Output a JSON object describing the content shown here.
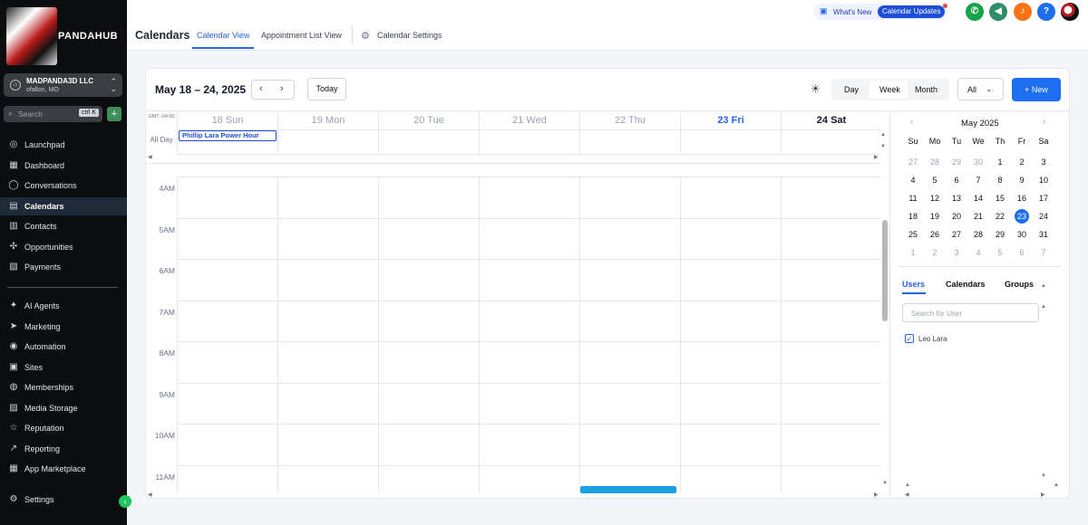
{
  "brand": {
    "name": "PANDAHUB"
  },
  "account": {
    "name": "MADPANDA3D LLC",
    "location": "ofallon, MO"
  },
  "sidebar_search": {
    "placeholder": "Search",
    "shortcut": "ctrl K"
  },
  "nav": {
    "primary": [
      {
        "label": "Launchpad",
        "icon": "rocket-icon"
      },
      {
        "label": "Dashboard",
        "icon": "grid-icon"
      },
      {
        "label": "Conversations",
        "icon": "chat-icon"
      },
      {
        "label": "Calendars",
        "icon": "calendar-icon",
        "active": true
      },
      {
        "label": "Contacts",
        "icon": "contacts-icon"
      },
      {
        "label": "Opportunities",
        "icon": "opportunities-icon"
      },
      {
        "label": "Payments",
        "icon": "payments-icon"
      }
    ],
    "secondary": [
      {
        "label": "AI Agents",
        "icon": "sparkle-icon"
      },
      {
        "label": "Marketing",
        "icon": "send-icon"
      },
      {
        "label": "Automation",
        "icon": "automation-icon"
      },
      {
        "label": "Sites",
        "icon": "sites-icon"
      },
      {
        "label": "Memberships",
        "icon": "memberships-icon"
      },
      {
        "label": "Media Storage",
        "icon": "media-icon"
      },
      {
        "label": "Reputation",
        "icon": "star-icon"
      },
      {
        "label": "Reporting",
        "icon": "chart-icon"
      },
      {
        "label": "App Marketplace",
        "icon": "apps-icon"
      }
    ],
    "settings": {
      "label": "Settings",
      "icon": "gear-icon"
    }
  },
  "header": {
    "title": "Calendars",
    "tabs": [
      "Calendar View",
      "Appointment List View",
      "Calendar Settings"
    ],
    "whats_new": "What's New",
    "updates_badge": "Calendar Updates",
    "help": "?",
    "colors": {
      "phone": "#16a34a",
      "megaphone": "#2f8f6b",
      "bell": "#f97316",
      "help": "#1d6ef0"
    }
  },
  "toolbar": {
    "date_range": "May 18 – 24, 2025",
    "today": "Today",
    "views": [
      "Day",
      "Week",
      "Month"
    ],
    "active_view": "Week",
    "filter": "All",
    "new": "+ New"
  },
  "week": {
    "timezone": "GMT -04:00",
    "allday_label": "All Day",
    "days": [
      {
        "label": "18 Sun"
      },
      {
        "label": "19 Mon"
      },
      {
        "label": "20 Tue"
      },
      {
        "label": "21 Wed"
      },
      {
        "label": "22 Thu"
      },
      {
        "label": "23 Fri",
        "today": true
      },
      {
        "label": "24 Sat"
      }
    ],
    "allday_event": "Phillip Lara Power Hour",
    "hours": [
      "4AM",
      "5AM",
      "6AM",
      "7AM",
      "8AM",
      "9AM",
      "10AM",
      "11AM"
    ]
  },
  "mini_calendar": {
    "title": "May 2025",
    "weekdays": [
      "Su",
      "Mo",
      "Tu",
      "We",
      "Th",
      "Fr",
      "Sa"
    ],
    "weeks": [
      [
        "27",
        "28",
        "29",
        "30",
        "1",
        "2",
        "3"
      ],
      [
        "4",
        "5",
        "6",
        "7",
        "8",
        "9",
        "10"
      ],
      [
        "11",
        "12",
        "13",
        "14",
        "15",
        "16",
        "17"
      ],
      [
        "18",
        "19",
        "20",
        "21",
        "22",
        "23",
        "24"
      ],
      [
        "25",
        "26",
        "27",
        "28",
        "29",
        "30",
        "31"
      ],
      [
        "1",
        "2",
        "3",
        "4",
        "5",
        "6",
        "7"
      ]
    ],
    "selected": "23"
  },
  "filters": {
    "tabs": [
      "Users",
      "Calendars",
      "Groups"
    ],
    "search_placeholder": "Search for User",
    "users": [
      "Leo Lara"
    ]
  }
}
